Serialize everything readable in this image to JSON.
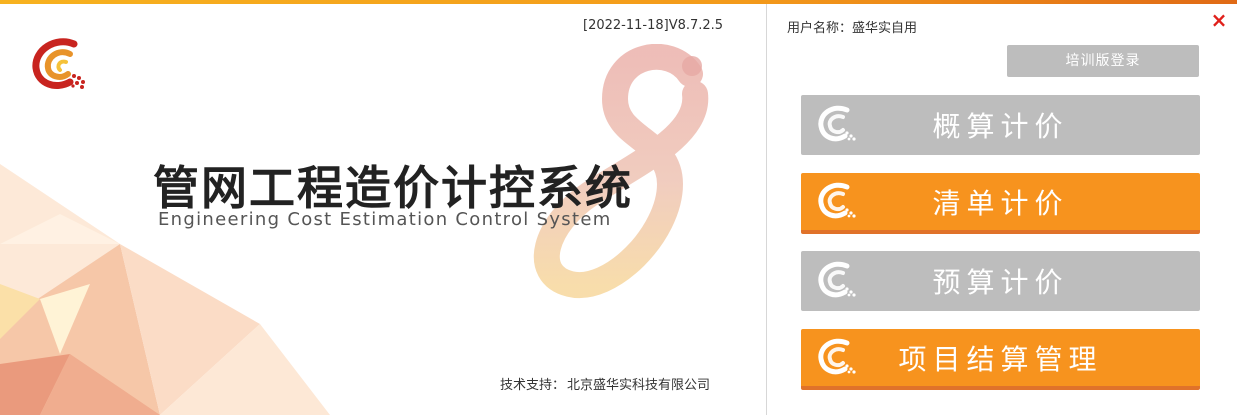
{
  "left": {
    "version": "[2022-11-18]V8.7.2.5",
    "title_cn": "管网工程造价计控系统",
    "title_en": "Engineering Cost Estimation Control System",
    "support_label": "技术支持：",
    "support_value": "北京盛华实科技有限公司"
  },
  "right": {
    "username_label": "用户名称：",
    "username_value": "盛华实自用",
    "close_icon": "×",
    "train_label": "培训版登录",
    "buttons": [
      {
        "label": "概算计价",
        "style": "gray"
      },
      {
        "label": "清单计价",
        "style": "orange"
      },
      {
        "label": "预算计价",
        "style": "gray"
      },
      {
        "label": "项目结算管理",
        "style": "orange"
      }
    ]
  },
  "colors": {
    "accent_orange": "#f7931e",
    "disabled_gray": "#bdbdbd",
    "close_red": "#e0201b"
  }
}
